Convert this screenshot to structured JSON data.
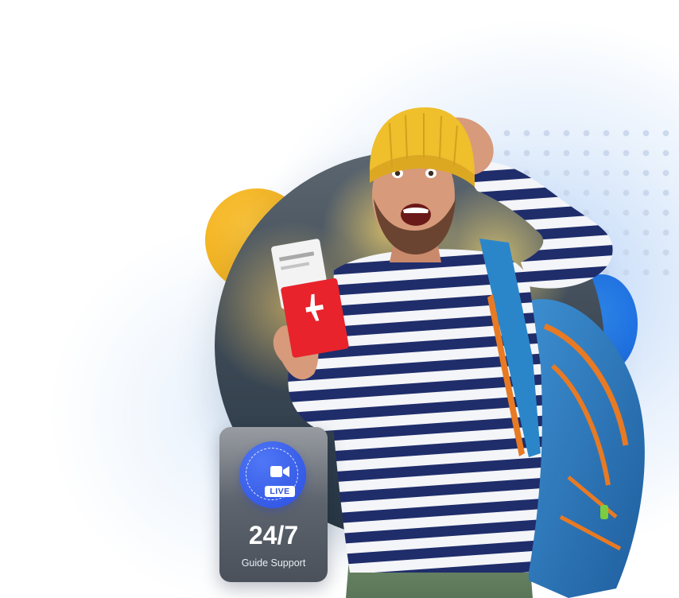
{
  "support_card": {
    "badge_label": "LIVE",
    "number": "24/7",
    "label": "Guide Support",
    "badge_icon": "video-camera-icon",
    "accent_color": "#3459e6"
  },
  "colors": {
    "yellow_accent": "#f2b01e",
    "blue_accent": "#1f6fe0",
    "dark_circle": "#3f4b57",
    "dot_grid": "#c9d7ec"
  }
}
